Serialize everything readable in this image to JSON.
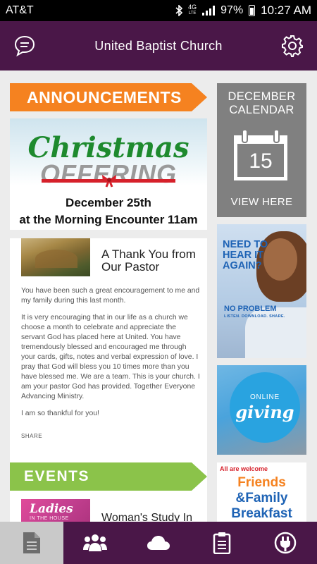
{
  "status_bar": {
    "carrier": "AT&T",
    "network": "4G",
    "network_sub": "LTE",
    "battery": "97%",
    "time": "10:27 AM"
  },
  "header": {
    "title": "United Baptist Church",
    "left_icon": "chat-icon",
    "right_icon": "gear-icon"
  },
  "announcements": {
    "label": "ANNOUNCEMENTS",
    "color": "#f58220",
    "featured": {
      "word1": "Christmas",
      "word2": "OFFERING",
      "line1": "December 25th",
      "line2": "at the Morning Encounter 11am"
    },
    "post": {
      "title": "A Thank You from Our Pastor",
      "paragraphs": [
        "You have been such a great encouragement to me and my family during this last month.",
        "It is very encouraging that in our life as a church we choose a month to celebrate and appreciate the servant God has placed here at United. You have tremendously blessed and encouraged me through your cards, gifts, notes and verbal expression of love. I pray that God will bless you 10 times more than you have blessed me. We are a team. This is your church. I am your pastor God has provided. Together Everyone Advancing Ministry.",
        "I am so thankful for you!"
      ],
      "share_label": "SHARE"
    }
  },
  "events": {
    "label": "EVENTS",
    "color": "#8bc34a",
    "item": {
      "thumb_title": "Ladies",
      "thumb_subtitle": "IN THE HOUSE",
      "title": "Woman's Study In"
    }
  },
  "tiles": {
    "calendar": {
      "month": "DECEMBER",
      "label": "CALENDAR",
      "day": "15",
      "cta": "VIEW HERE"
    },
    "need_it": {
      "headline": "NEED TO HEAR IT AGAIN?",
      "sub": "NO PROBLEM",
      "tagline": "LISTEN. DOWNLOAD. SHARE."
    },
    "giving": {
      "top": "ONLINE",
      "word": "giving"
    },
    "breakfast": {
      "welcome": "All are welcome",
      "line1": "Friends",
      "line2": "&Family",
      "line3": "Breakfast"
    }
  },
  "bottom_nav": {
    "active_index": 0,
    "tabs": [
      "document-icon",
      "people-icon",
      "cloud-icon",
      "clipboard-icon",
      "plug-icon"
    ]
  },
  "colors": {
    "brand": "#4a1748",
    "active_tab": "#c9c9c9"
  }
}
